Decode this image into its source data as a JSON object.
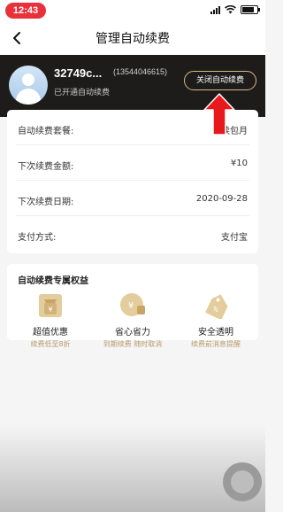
{
  "status_bar": {
    "time": "12:43"
  },
  "nav": {
    "title": "管理自动续费",
    "back_icon": "back-chevron-icon"
  },
  "header": {
    "username": "32749c...",
    "phone": "(13544046615)",
    "status": "已开通自动续费",
    "close_button": "关闭自动续费"
  },
  "info": {
    "rows": [
      {
        "label": "自动续费套餐:",
        "value": "连续包月"
      },
      {
        "label": "下次续费金额:",
        "value": "¥10"
      },
      {
        "label": "下次续费日期:",
        "value": "2020-09-28"
      },
      {
        "label": "支付方式:",
        "value": "支付宝"
      }
    ]
  },
  "benefits": {
    "title": "自动续费专属权益",
    "items": [
      {
        "icon": "money-bag-icon",
        "name": "超值优惠",
        "desc": "续费低至8折"
      },
      {
        "icon": "coin-wallet-icon",
        "name": "省心省力",
        "desc": "到期续费  随时取消"
      },
      {
        "icon": "price-tag-icon",
        "name": "安全透明",
        "desc": "续费前消息提醒"
      }
    ]
  },
  "colors": {
    "accent_gold": "#d9b882",
    "header_bg": "#1e1c1b",
    "arrow_red": "#e8191c",
    "time_pill": "#e8313a"
  }
}
